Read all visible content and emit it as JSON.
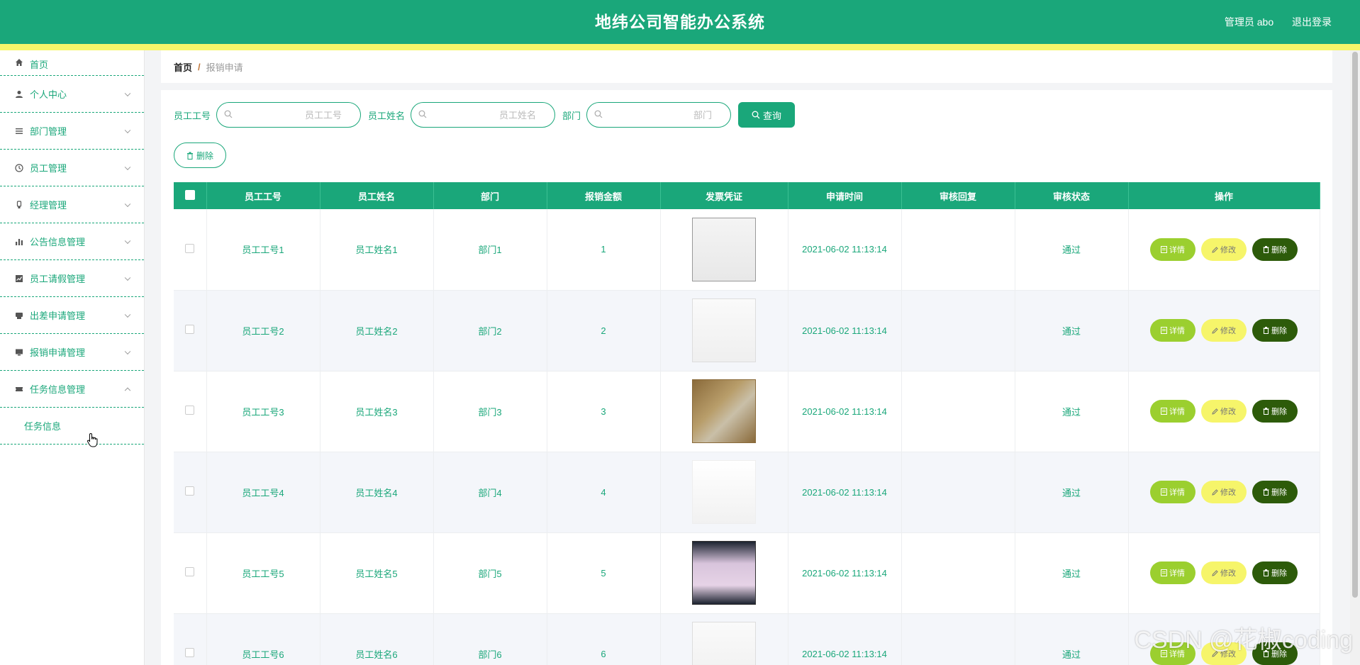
{
  "header": {
    "title": "地纬公司智能办公系统",
    "user": "管理员 abo",
    "logout": "退出登录"
  },
  "sidebar": {
    "items": [
      {
        "label": "首页",
        "icon": "home-icon"
      },
      {
        "label": "个人中心",
        "icon": "user-icon"
      },
      {
        "label": "部门管理",
        "icon": "list-icon"
      },
      {
        "label": "员工管理",
        "icon": "clock-icon"
      },
      {
        "label": "经理管理",
        "icon": "badge-icon"
      },
      {
        "label": "公告信息管理",
        "icon": "bar-chart-icon"
      },
      {
        "label": "员工请假管理",
        "icon": "line-chart-icon"
      },
      {
        "label": "出差申请管理",
        "icon": "printer-icon"
      },
      {
        "label": "报销申请管理",
        "icon": "monitor-icon"
      },
      {
        "label": "任务信息管理",
        "icon": "ticket-icon"
      }
    ],
    "sub_item": "任务信息"
  },
  "breadcrumb": {
    "home": "首页",
    "separator": "/",
    "current": "报销申请"
  },
  "search": {
    "emp_no_label": "员工工号",
    "emp_no_placeholder": "员工工号",
    "emp_name_label": "员工姓名",
    "emp_name_placeholder": "员工姓名",
    "dept_label": "部门",
    "dept_placeholder": "部门",
    "query_label": "查询"
  },
  "toolbar": {
    "delete_label": "删除"
  },
  "table": {
    "columns": [
      "员工工号",
      "员工姓名",
      "部门",
      "报销金额",
      "发票凭证",
      "申请时间",
      "审核回复",
      "审核状态",
      "操作"
    ],
    "actions": {
      "detail": "详情",
      "edit": "修改",
      "delete": "删除"
    },
    "rows": [
      {
        "emp_no": "员工工号1",
        "emp_name": "员工姓名1",
        "dept": "部门1",
        "amount": "1",
        "time": "2021-06-02 11:13:14",
        "reply": "",
        "status": "通过"
      },
      {
        "emp_no": "员工工号2",
        "emp_name": "员工姓名2",
        "dept": "部门2",
        "amount": "2",
        "time": "2021-06-02 11:13:14",
        "reply": "",
        "status": "通过"
      },
      {
        "emp_no": "员工工号3",
        "emp_name": "员工姓名3",
        "dept": "部门3",
        "amount": "3",
        "time": "2021-06-02 11:13:14",
        "reply": "",
        "status": "通过"
      },
      {
        "emp_no": "员工工号4",
        "emp_name": "员工姓名4",
        "dept": "部门4",
        "amount": "4",
        "time": "2021-06-02 11:13:14",
        "reply": "",
        "status": "通过"
      },
      {
        "emp_no": "员工工号5",
        "emp_name": "员工姓名5",
        "dept": "部门5",
        "amount": "5",
        "time": "2021-06-02 11:13:14",
        "reply": "",
        "status": "通过"
      },
      {
        "emp_no": "员工工号6",
        "emp_name": "员工姓名6",
        "dept": "部门6",
        "amount": "6",
        "time": "2021-06-02 11:13:14",
        "reply": "",
        "status": "通过"
      }
    ]
  },
  "watermark": "CSDN @花椒coding",
  "colors": {
    "primary": "#1aa77a",
    "stripe": "#f6f56a",
    "detail": "#9bcf2f",
    "edit": "#f6f56a",
    "delete": "#2d5b0a"
  }
}
